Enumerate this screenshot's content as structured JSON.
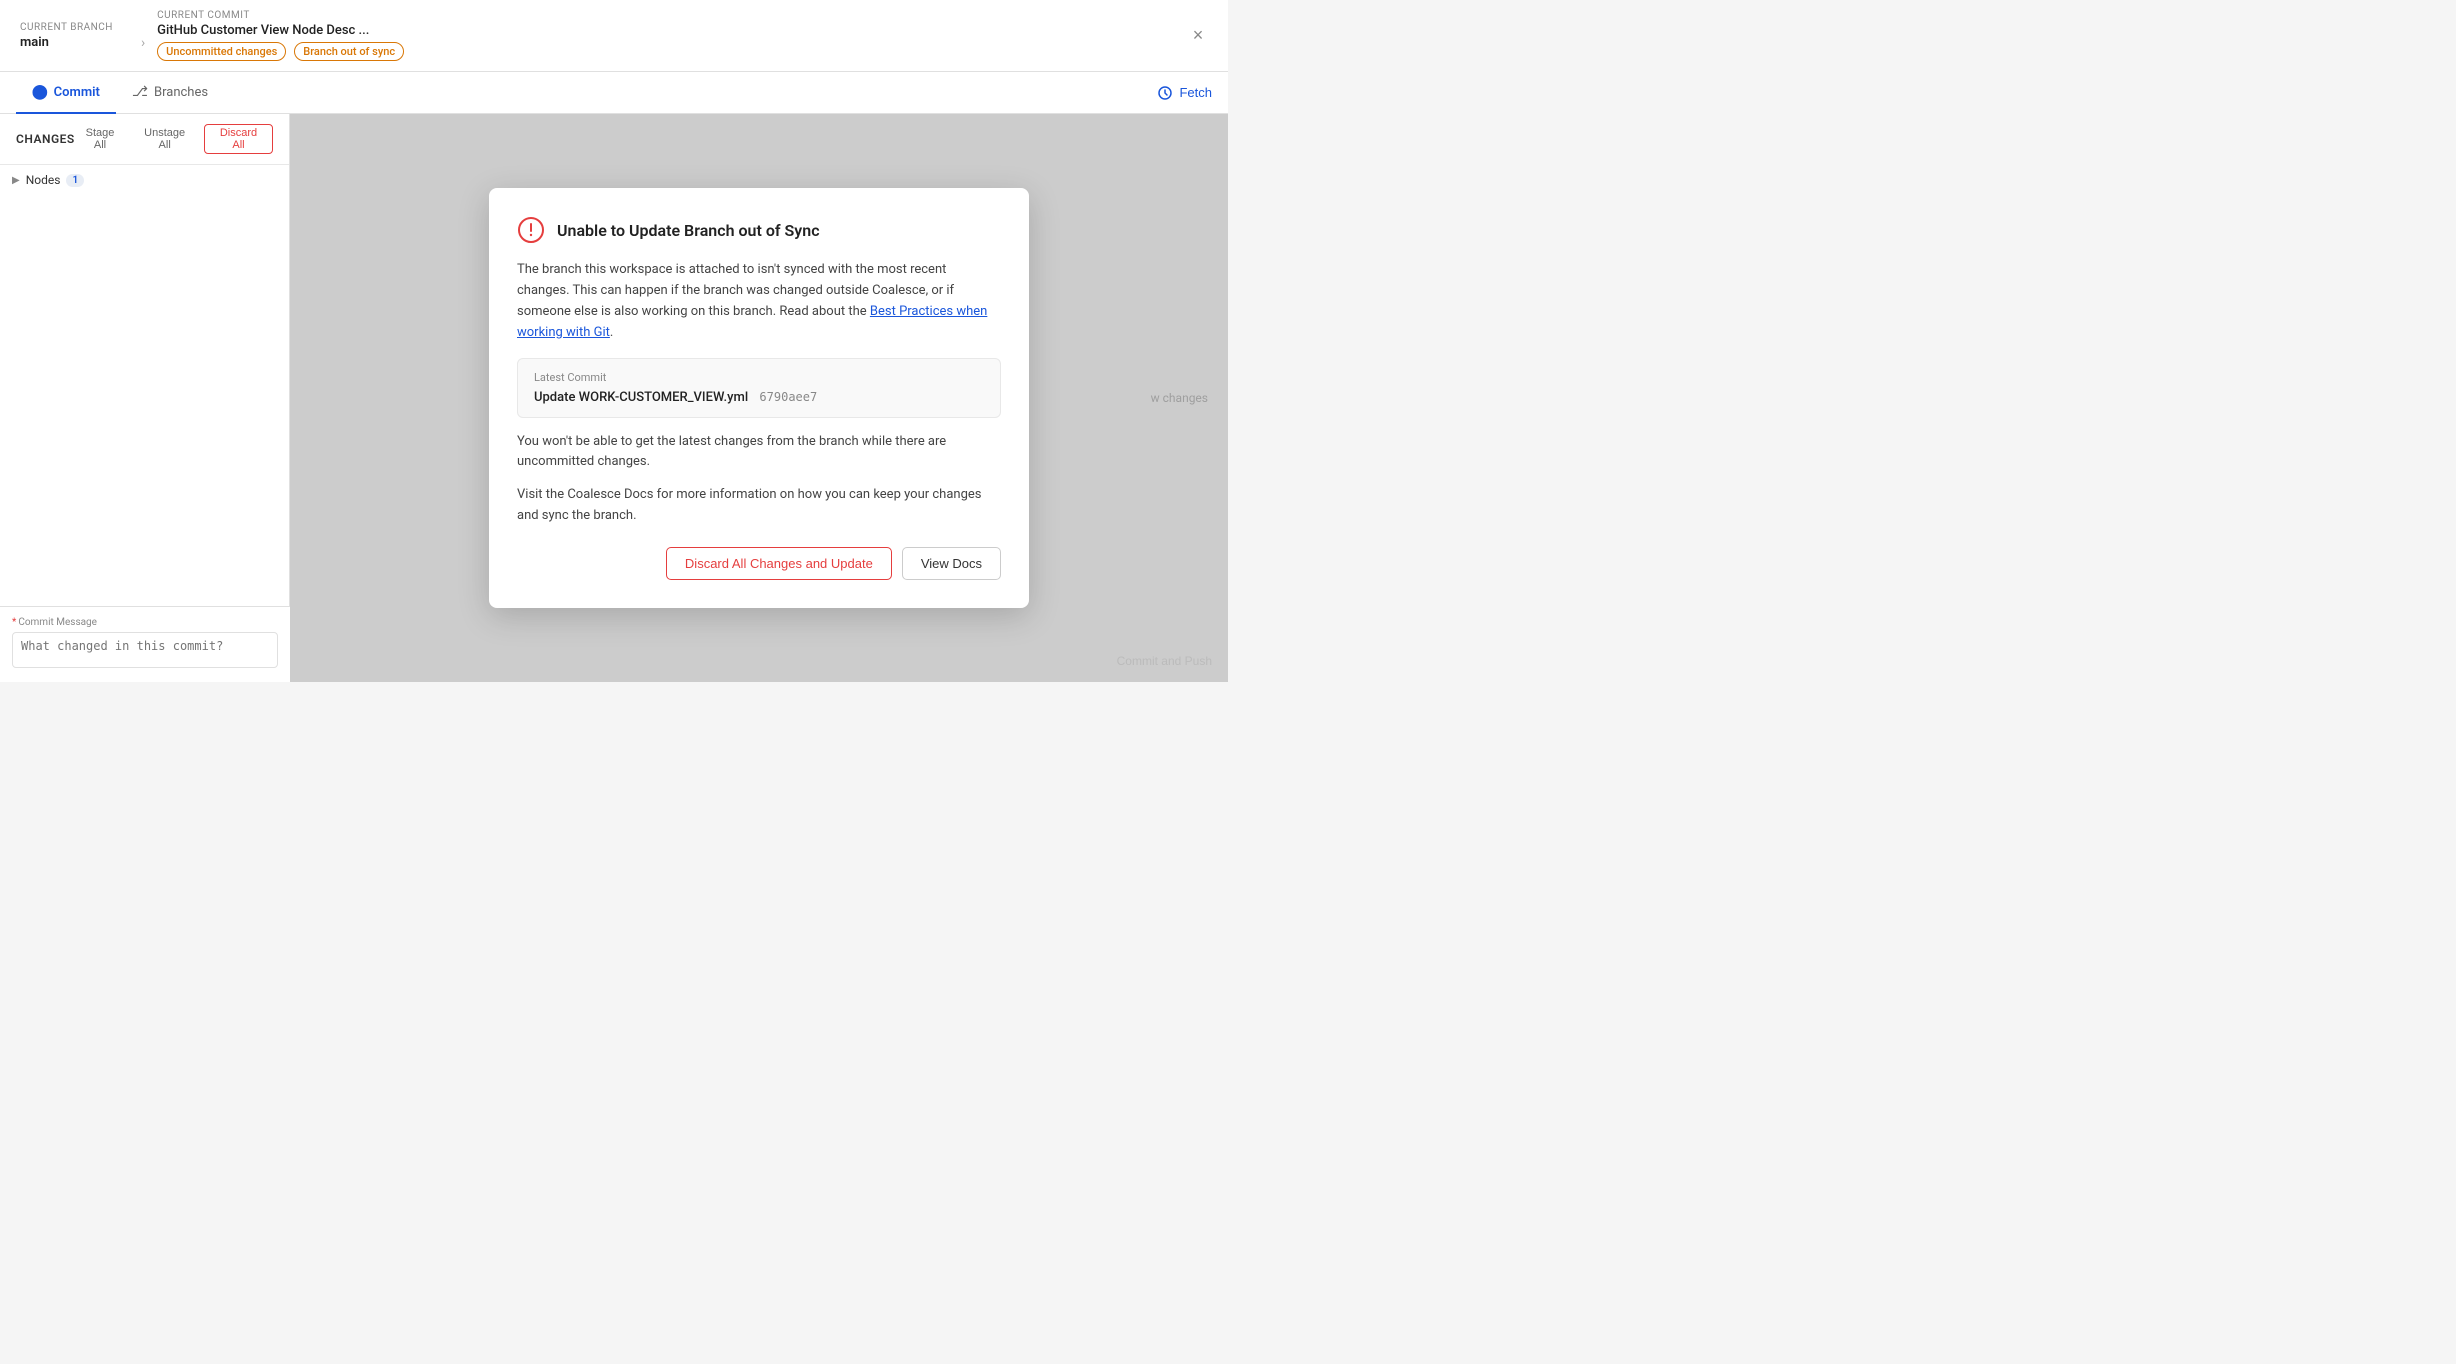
{
  "header": {
    "current_branch_label": "Current Branch",
    "current_branch_value": "main",
    "current_commit_label": "Current Commit",
    "current_commit_value": "GitHub Customer View Node Desc ...",
    "badge_uncommitted": "Uncommitted changes",
    "badge_out_of_sync": "Branch out of sync",
    "close_label": "×"
  },
  "tabs": {
    "commit_label": "Commit",
    "branches_label": "Branches",
    "fetch_label": "Fetch"
  },
  "sidebar": {
    "changes_title": "Changes",
    "stage_all_label": "Stage All",
    "unstage_all_label": "Unstage All",
    "discard_all_label": "Discard All",
    "nodes_label": "Nodes",
    "nodes_count": "1"
  },
  "modal": {
    "title": "Unable to Update Branch out of Sync",
    "body_text": "The branch this workspace is attached to isn't synced with the most recent changes. This can happen if the branch was changed outside Coalesce, or if someone else is also working on this branch. Read about the",
    "link_text": "Best Practices when working with Git",
    "body_text_end": ".",
    "latest_commit_label": "Latest Commit",
    "latest_commit_message": "Update WORK-CUSTOMER_VIEW.yml",
    "latest_commit_hash": "6790aee7",
    "warning_text_1": "You won't be able to get the latest changes from the branch while there are uncommitted changes.",
    "warning_text_2": "Visit the Coalesce Docs for more information on how you can keep your changes and sync the branch.",
    "discard_btn": "Discard All Changes and Update",
    "view_docs_btn": "View Docs"
  },
  "commit_area": {
    "label_star": "*",
    "label_text": "Commit Message",
    "placeholder": "What changed in this commit?",
    "commit_push_label": "Commit and Push"
  },
  "right_panel": {
    "view_changes_text": "w changes"
  }
}
